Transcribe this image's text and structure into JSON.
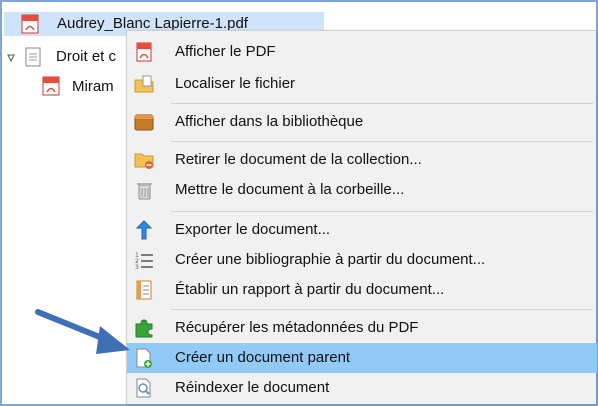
{
  "tree": {
    "selected_file": "Audrey_Blanc Lapierre-1.pdf",
    "doc_node": "Droit et c",
    "child_node": "Miram"
  },
  "menu": {
    "items": [
      {
        "label": "Afficher le PDF",
        "icon": "pdf-icon"
      },
      {
        "label": "Localiser le fichier",
        "icon": "folder-file-icon"
      },
      {
        "label": "Afficher dans la bibliothèque",
        "icon": "library-icon"
      },
      {
        "label": "Retirer le document de la collection...",
        "icon": "folder-remove-icon"
      },
      {
        "label": "Mettre le document à la corbeille...",
        "icon": "trash-icon"
      },
      {
        "label": "Exporter le document...",
        "icon": "export-arrow-icon"
      },
      {
        "label": "Créer une bibliographie à partir du document...",
        "icon": "list-icon"
      },
      {
        "label": "Établir un rapport à partir du document...",
        "icon": "report-icon"
      },
      {
        "label": "Récupérer les métadonnées du PDF",
        "icon": "puzzle-icon"
      },
      {
        "label": "Créer un document parent",
        "icon": "new-document-icon"
      },
      {
        "label": "Réindexer le document",
        "icon": "reindex-icon"
      }
    ],
    "highlighted_index": 9
  },
  "colors": {
    "highlight": "#91c9f7",
    "selection": "#cfe3fb",
    "arrow": "#3f6fb5",
    "frame": "#7ea6d8"
  }
}
